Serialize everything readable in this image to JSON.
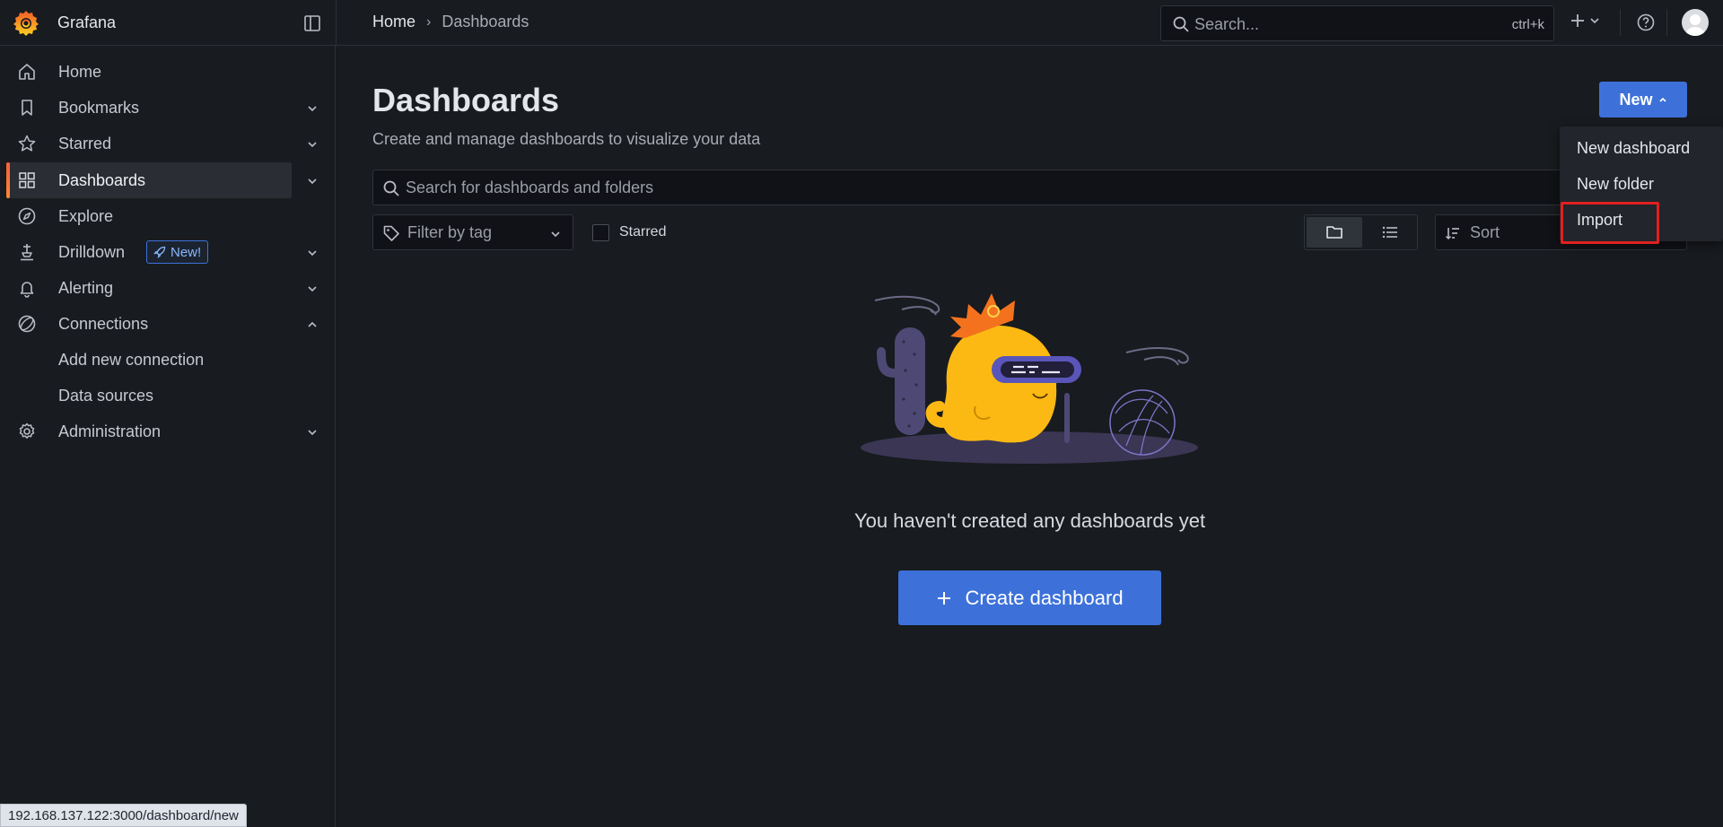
{
  "app": {
    "name": "Grafana"
  },
  "breadcrumb": {
    "home": "Home",
    "current": "Dashboards"
  },
  "global_search": {
    "placeholder": "Search...",
    "shortcut": "ctrl+k"
  },
  "sidebar": {
    "items": [
      {
        "label": "Home",
        "icon": "home-icon",
        "expandable": false
      },
      {
        "label": "Bookmarks",
        "icon": "bookmark-icon",
        "expandable": true
      },
      {
        "label": "Starred",
        "icon": "star-icon",
        "expandable": true
      },
      {
        "label": "Dashboards",
        "icon": "apps-icon",
        "expandable": true,
        "active": true
      },
      {
        "label": "Explore",
        "icon": "compass-icon",
        "expandable": false
      },
      {
        "label": "Drilldown",
        "icon": "drilldown-icon",
        "expandable": true,
        "badge": "New!"
      },
      {
        "label": "Alerting",
        "icon": "bell-icon",
        "expandable": true
      },
      {
        "label": "Connections",
        "icon": "connections-icon",
        "expandable": true,
        "expanded": true
      },
      {
        "label": "Administration",
        "icon": "cog-icon",
        "expandable": true
      }
    ],
    "connections_children": [
      "Add new connection",
      "Data sources"
    ]
  },
  "page": {
    "title": "Dashboards",
    "subtitle": "Create and manage dashboards to visualize your data",
    "new_button": "New",
    "search_placeholder": "Search for dashboards and folders",
    "tag_filter_placeholder": "Filter by tag",
    "starred_label": "Starred",
    "sort_placeholder": "Sort",
    "empty_message": "You haven't created any dashboards yet",
    "create_button": "Create dashboard"
  },
  "new_menu": {
    "items": [
      "New dashboard",
      "New folder",
      "Import"
    ],
    "highlighted": "Import"
  },
  "status_url": "192.168.137.122:3000/dashboard/new",
  "colors": {
    "primary": "#3d71d9",
    "background": "#181b1f",
    "accent_orange": "#f55f3e",
    "highlight_red": "#e02020"
  }
}
